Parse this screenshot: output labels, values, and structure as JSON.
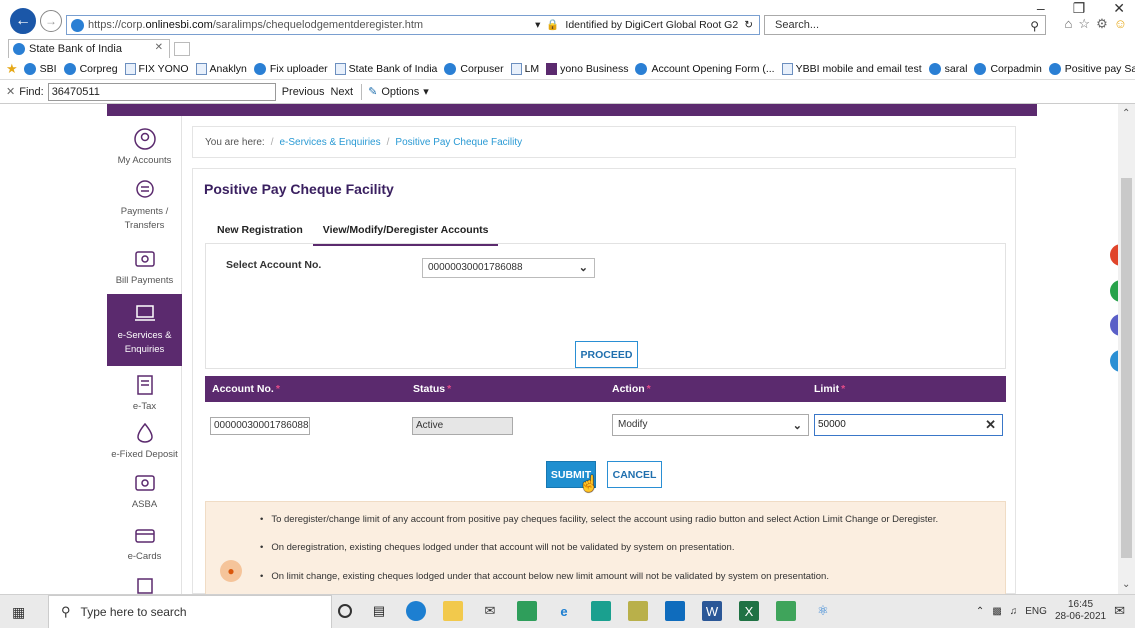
{
  "browser": {
    "url_prefix": "https://corp.",
    "url_domain": "onlinesbi.com",
    "url_path": "/saralimps/chequelodgementderegister.htm",
    "cert": "Identified by DigiCert Global Root G2",
    "search_placeholder": "Search...",
    "tab_title": "State Bank of India",
    "favorites": [
      "SBI",
      "Corpreg",
      "FIX YONO",
      "Anaklyn",
      "Fix uploader",
      "State Bank of India",
      "Corpuser",
      "LM",
      "yono Business",
      "Account Opening Form (...",
      "YBBI mobile and email test",
      "saral",
      "Corpadmin",
      "Positive pay Saral"
    ],
    "find_label": "Find:",
    "find_value": "36470511",
    "find_previous": "Previous",
    "find_next": "Next",
    "find_options": "Options"
  },
  "sidebar": {
    "items": [
      {
        "label": "My Accounts",
        "icon": "user-circle-icon"
      },
      {
        "label": "Payments / Transfers",
        "icon": "payments-icon"
      },
      {
        "label": "Bill Payments",
        "icon": "bill-icon"
      },
      {
        "label": "e-Services & Enquiries",
        "icon": "laptop-icon"
      },
      {
        "label": "e-Tax",
        "icon": "tax-icon"
      },
      {
        "label": "e-Fixed Deposit",
        "icon": "deposit-icon"
      },
      {
        "label": "ASBA",
        "icon": "asba-icon"
      },
      {
        "label": "e-Cards",
        "icon": "card-icon"
      }
    ]
  },
  "breadcrumb": {
    "prefix": "You are here:",
    "links": [
      "e-Services & Enquiries",
      "Positive Pay Cheque Facility"
    ]
  },
  "panel": {
    "title": "Positive Pay Cheque Facility",
    "tabs": [
      "New Registration",
      "View/Modify/Deregister Accounts"
    ],
    "select_label": "Select Account No.",
    "selected_account": "00000030001786088",
    "proceed": "PROCEED"
  },
  "table": {
    "headers": [
      "Account No.",
      "Status",
      "Action",
      "Limit"
    ],
    "row": {
      "account": "00000030001786088",
      "status": "Active",
      "action": "Modify",
      "limit": "50000"
    }
  },
  "buttons": {
    "submit": "SUBMIT",
    "cancel": "CANCEL"
  },
  "notes": [
    "To deregister/change limit of any account from positive pay cheques facility, select the account using radio button and select Action Limit Change or Deregister.",
    "On deregistration, existing cheques lodged under that account will not be validated by system on presentation.",
    "On limit change, existing cheques lodged under that account below new limit amount will not be validated by system on presentation."
  ],
  "taskbar": {
    "search_placeholder": "Type here to search",
    "lang": "ENG",
    "time": "16:45",
    "date": "28-06-2021"
  },
  "colors": {
    "brand": "#5b2a6e",
    "link": "#2a9ad4",
    "button": "#1f8fd0"
  }
}
